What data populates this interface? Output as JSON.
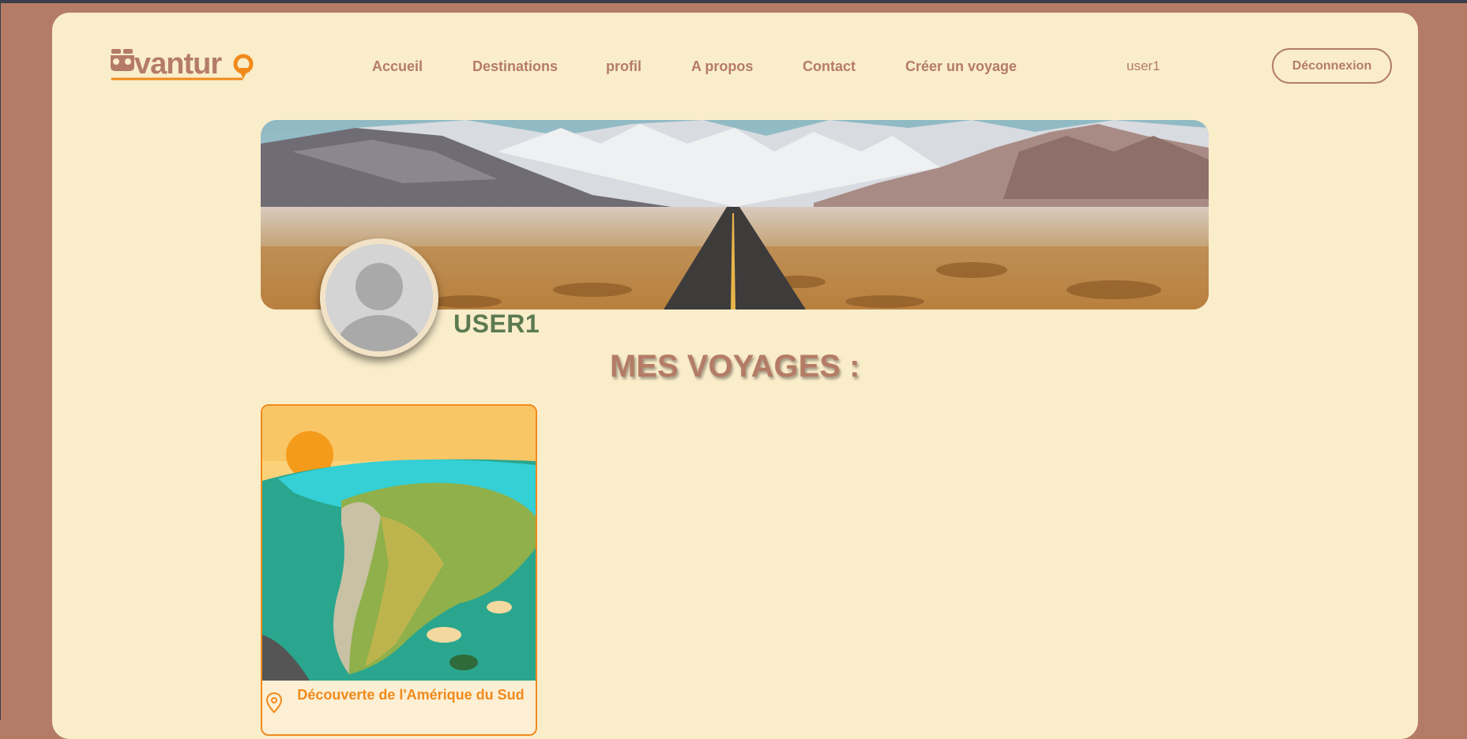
{
  "brand": {
    "logo_text": "vantura"
  },
  "nav": {
    "items": [
      {
        "label": "Accueil",
        "name": "nav-accueil"
      },
      {
        "label": "Destinations",
        "name": "nav-destinations"
      },
      {
        "label": "profil",
        "name": "nav-profil"
      },
      {
        "label": "A propos",
        "name": "nav-a-propos"
      },
      {
        "label": "Contact",
        "name": "nav-contact"
      },
      {
        "label": "Créer un voyage",
        "name": "nav-creer-voyage"
      }
    ]
  },
  "header": {
    "username": "user1",
    "logout_label": "Déconnexion"
  },
  "profile": {
    "name": "USER1"
  },
  "section": {
    "title": "MES VOYAGES :"
  },
  "trips": [
    {
      "title": "Découverte de l'Amérique du Sud"
    }
  ],
  "colors": {
    "outer_bg": "#b47c66",
    "page_bg": "#faedca",
    "accent": "#b47c66",
    "card_accent": "#f08a1c",
    "profile_name": "#5b7a50"
  }
}
